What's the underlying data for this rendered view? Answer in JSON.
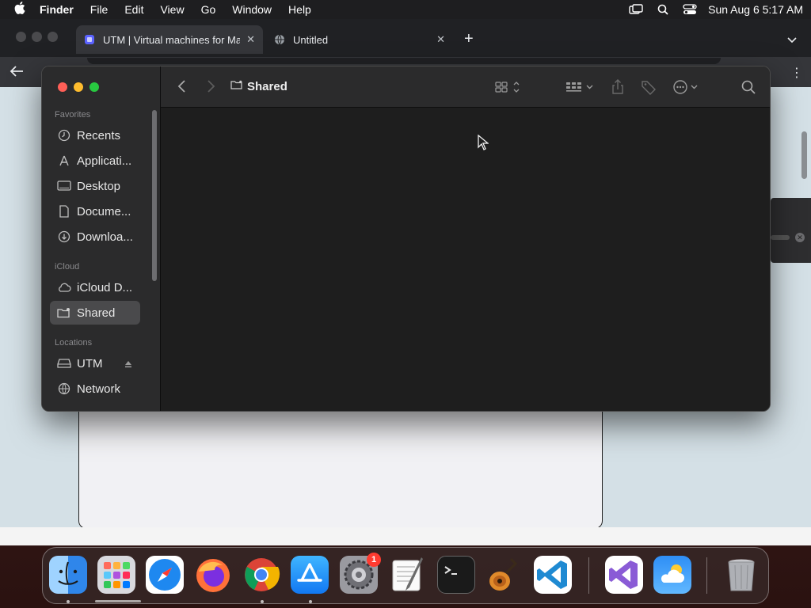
{
  "menubar": {
    "app_name": "Finder",
    "items": [
      "File",
      "Edit",
      "View",
      "Go",
      "Window",
      "Help"
    ],
    "clock": "Sun Aug 6  5:17 AM",
    "status_icons": [
      "screen-mirroring-icon",
      "spotlight-search-icon",
      "control-center-icon"
    ]
  },
  "browser": {
    "tabs": [
      {
        "title": "UTM | Virtual machines for Mac",
        "favicon": "utm-icon",
        "active": true
      },
      {
        "title": "Untitled",
        "favicon": "globe-icon",
        "active": false
      }
    ]
  },
  "finder": {
    "location_title": "Shared",
    "sidebar": {
      "sections": [
        {
          "title": "Favorites",
          "items": [
            {
              "label": "Recents",
              "icon": "clock-icon"
            },
            {
              "label": "Applicati...",
              "icon": "applications-icon"
            },
            {
              "label": "Desktop",
              "icon": "desktop-icon"
            },
            {
              "label": "Docume...",
              "icon": "document-icon"
            },
            {
              "label": "Downloa...",
              "icon": "download-icon"
            }
          ]
        },
        {
          "title": "iCloud",
          "items": [
            {
              "label": "iCloud D...",
              "icon": "cloud-icon"
            },
            {
              "label": "Shared",
              "icon": "shared-folder-icon",
              "selected": true
            }
          ]
        },
        {
          "title": "Locations",
          "items": [
            {
              "label": "UTM",
              "icon": "drive-icon",
              "eject": true
            },
            {
              "label": "Network",
              "icon": "network-globe-icon"
            }
          ]
        }
      ]
    },
    "toolbar_icons": [
      "back-icon",
      "forward-icon",
      "icon-view-icon",
      "group-icon",
      "share-icon",
      "tag-icon",
      "more-actions-icon",
      "search-icon"
    ]
  },
  "dock": {
    "apps": [
      "Finder",
      "Launchpad",
      "Safari",
      "Firefox",
      "Google Chrome",
      "App Store",
      "System Settings",
      "TextEdit",
      "Terminal",
      "GarageBand",
      "Visual Studio Code",
      "Visual Studio",
      "Weather",
      "Trash"
    ],
    "settings_badge": "1"
  },
  "colors": {
    "accent_red": "#ff5f57",
    "accent_yellow": "#febc2e",
    "accent_green": "#28c840",
    "finder_bg": "#1e1e1e",
    "sidebar_bg": "#2b2b2c"
  }
}
